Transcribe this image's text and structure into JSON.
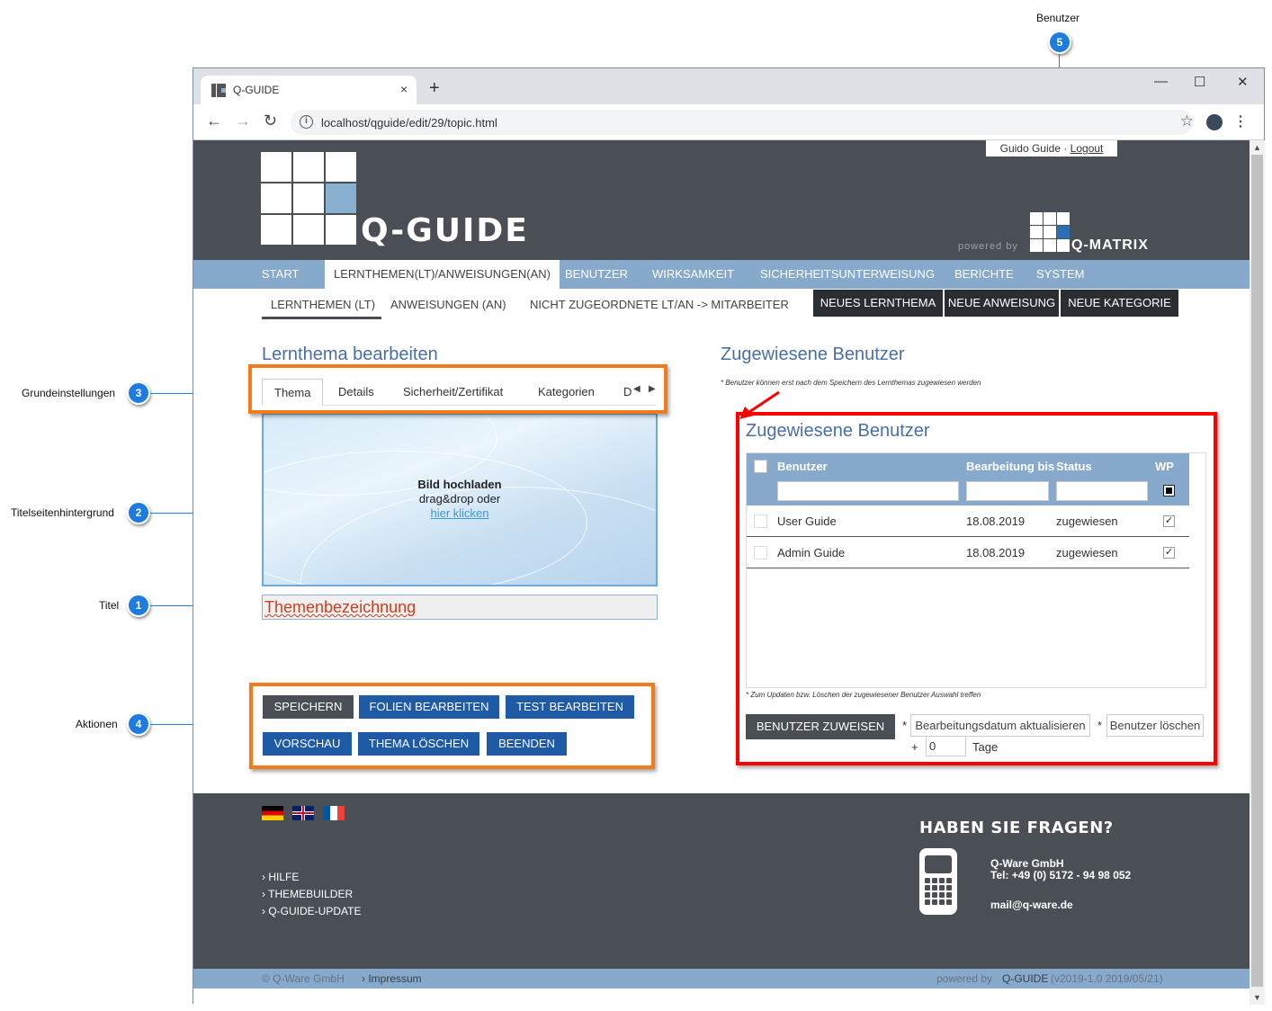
{
  "callouts": {
    "c5": {
      "num": "5",
      "label": "Benutzer"
    },
    "c3": {
      "num": "3",
      "label": "Grundeinstellungen"
    },
    "c2": {
      "num": "2",
      "label": "Titelseitenhintergrund"
    },
    "c1": {
      "num": "1",
      "label": "Titel"
    },
    "c4": {
      "num": "4",
      "label": "Aktionen"
    }
  },
  "browser": {
    "tab_title": "Q-GUIDE",
    "tab_close": "×",
    "new_tab": "+",
    "minimize": "—",
    "maximize": "☐",
    "close": "✕",
    "back": "←",
    "forward": "→",
    "reload": "↻",
    "info": "i",
    "url": "localhost/qguide/edit/29/topic.html",
    "star": "☆",
    "menu": "⋮"
  },
  "header": {
    "user": "Guido Guide",
    "separator": " · ",
    "logout": "Logout",
    "logo_text": "Q-GUIDE",
    "powered_by": "powered by",
    "qmatrix": "Q-MATRIX"
  },
  "main_nav": [
    {
      "label": "START",
      "active": false
    },
    {
      "label": "LERNTHEMEN(LT)/ANWEISUNGEN(AN)",
      "active": true
    },
    {
      "label": "BENUTZER",
      "active": false
    },
    {
      "label": "WIRKSAMKEIT",
      "active": false
    },
    {
      "label": "SICHERHEITSUNTERWEISUNG",
      "active": false
    },
    {
      "label": "BERICHTE",
      "active": false
    },
    {
      "label": "SYSTEM",
      "active": false
    }
  ],
  "sub_nav": {
    "items": [
      "LERNTHEMEN (LT)",
      "ANWEISUNGEN (AN)",
      "NICHT ZUGEORDNETE LT/AN -> MITARBEITER"
    ],
    "buttons": [
      "NEUES LERNTHEMA",
      "NEUE ANWEISUNG",
      "NEUE KATEGORIE"
    ]
  },
  "editor": {
    "title": "Lernthema bearbeiten",
    "tabs": [
      "Thema",
      "Details",
      "Sicherheit/Zertifikat",
      "Kategorien",
      "D"
    ],
    "upload_title": "Bild hochladen",
    "upload_sub": "drag&drop oder",
    "upload_link": "hier klicken",
    "title_value": "Themenbezeichnung",
    "actions_row1": [
      "SPEICHERN",
      "FOLIEN BEARBEITEN",
      "TEST BEARBEITEN"
    ],
    "actions_row2": [
      "VORSCHAU",
      "THEMA LÖSCHEN",
      "BEENDEN"
    ]
  },
  "users": {
    "section_title": "Zugewiesene Benutzer",
    "note_top": "* Benutzer können erst nach dem Speichern des Lernthemas zugewiesen werden",
    "panel_title": "Zugewiesene Benutzer",
    "columns": [
      "Benutzer",
      "Bearbeitung bis",
      "Status",
      "WP"
    ],
    "rows": [
      {
        "name": "User Guide",
        "date": "18.08.2019",
        "status": "zugewiesen",
        "wp": "✓"
      },
      {
        "name": "Admin Guide",
        "date": "18.08.2019",
        "status": "zugewiesen",
        "wp": "✓"
      }
    ],
    "note_bottom": "* Zum Updaten bzw. Löschen der zugewiesener Benutzer Auswahl treffen",
    "assign_button": "BENUTZER ZUWEISEN",
    "star": "*",
    "update_button": "Bearbeitungsdatum aktualisieren",
    "delete_button": "Benutzer löschen",
    "plus": "+",
    "days_value": "0",
    "days_label": "Tage"
  },
  "footer": {
    "links": [
      "› HILFE",
      "› THEMEBUILDER",
      "› Q-GUIDE-UPDATE"
    ],
    "faq": "HABEN SIE FRAGEN?",
    "company": "Q-Ware GmbH",
    "tel": "Tel: +49 (0) 5172 - 94 98 052",
    "mail": "mail@q-ware.de",
    "copyright": "© Q-Ware GmbH",
    "impressum": "› Impressum",
    "powered": "powered by",
    "powered_brand": "Q-GUIDE",
    "version": "(v2019-1.0 2019/05/21)"
  },
  "colors": {
    "accent_blue": "#86a9cc",
    "dark": "#4a4f55",
    "highlight_orange": "#f07d1a",
    "highlight_red": "#ff0000",
    "callout_blue": "#1e7be0"
  }
}
